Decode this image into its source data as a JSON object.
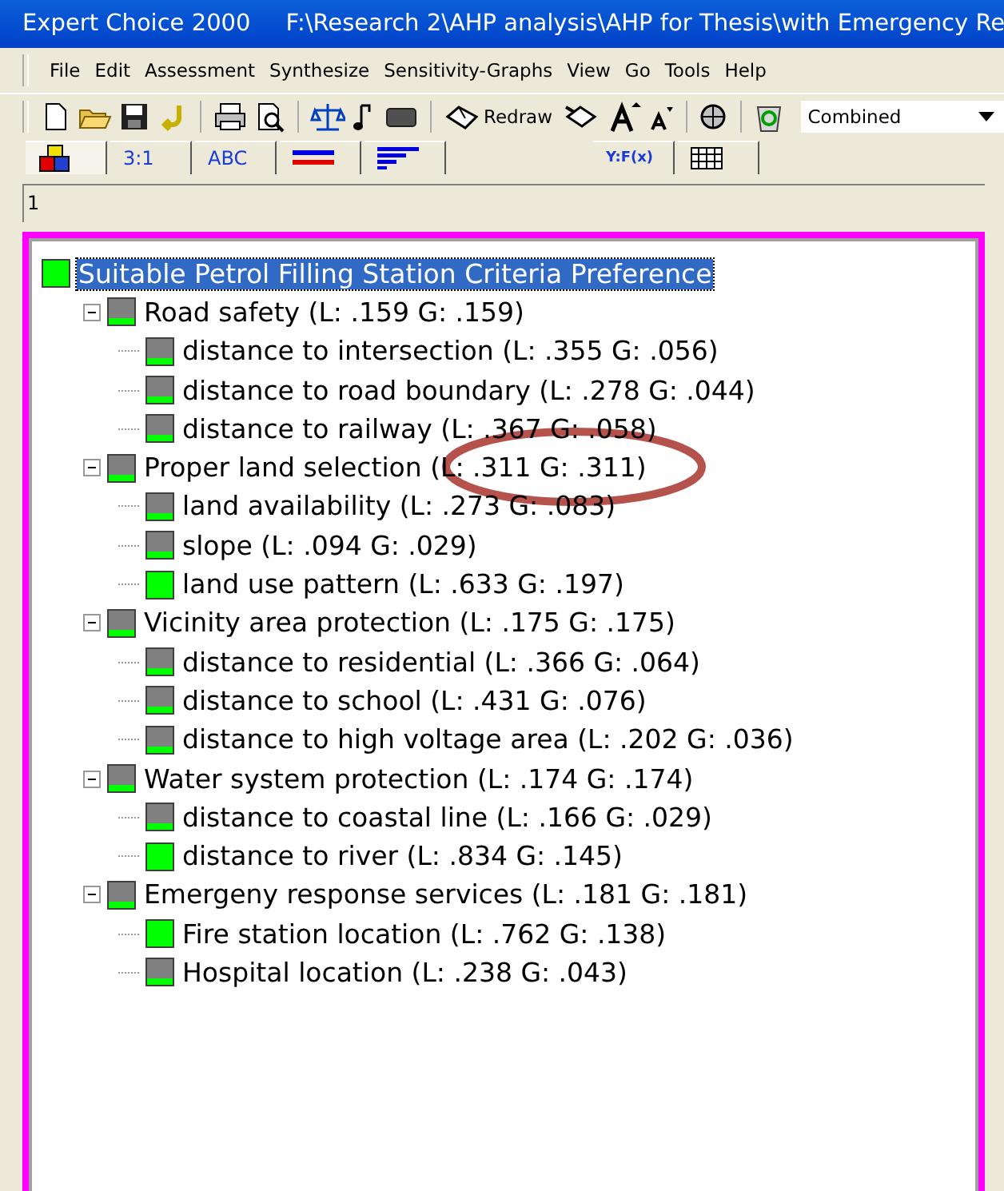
{
  "window": {
    "title_app": "Expert Choice 2000",
    "title_path": "F:\\Research 2\\AHP analysis\\AHP for Thesis\\with Emergency Re"
  },
  "menu": [
    "File",
    "Edit",
    "Assessment",
    "Synthesize",
    "Sensitivity-Graphs",
    "View",
    "Go",
    "Tools",
    "Help"
  ],
  "toolbar": {
    "redraw_label": "Redraw",
    "combo_value": "Combined"
  },
  "tabs": [
    {
      "selected": true
    },
    {
      "label": "3:1",
      "selected": false
    },
    {
      "label": "ABC",
      "selected": false
    },
    {
      "selected": false
    },
    {
      "selected": false
    },
    {
      "label": "Y:F(x)",
      "selected": false
    },
    {
      "selected": false
    }
  ],
  "path_field": {
    "value": "1"
  },
  "tree": {
    "label": "Suitable Petrol Filling Station Criteria Preference",
    "color": "#00ff00",
    "selected": true,
    "children": [
      {
        "label": "Road safety (L: .159  G: .159)",
        "color": "#808080",
        "selected": false,
        "expanded": true,
        "children": [
          {
            "label": "distance to intersection (L: .355  G: .056)",
            "color": "#808080",
            "selected": false
          },
          {
            "label": "distance to road boundary (L: .278  G: .044)",
            "color": "#808080",
            "selected": false
          },
          {
            "label": "distance to railway (L: .367  G: .058)",
            "color": "#808080",
            "selected": false
          }
        ]
      },
      {
        "label": "Proper land selection (L: .311  G: .311)",
        "color": "#808080",
        "selected": false,
        "expanded": true,
        "children": [
          {
            "label": "land availability (L: .273  G: .083)",
            "color": "#808080",
            "selected": false
          },
          {
            "label": "slope (L: .094  G: .029)",
            "color": "#808080",
            "selected": false
          },
          {
            "label": "land use pattern (L: .633  G: .197)",
            "color": "#00ff00",
            "selected": false
          }
        ]
      },
      {
        "label": "Vicinity area protection (L: .175  G: .175)",
        "color": "#808080",
        "selected": false,
        "expanded": true,
        "children": [
          {
            "label": "distance to residential (L: .366  G: .064)",
            "color": "#808080",
            "selected": false
          },
          {
            "label": "distance to school (L: .431  G: .076)",
            "color": "#808080",
            "selected": false
          },
          {
            "label": "distance to high voltage area (L: .202  G: .036)",
            "color": "#808080",
            "selected": false
          }
        ]
      },
      {
        "label": "Water system protection (L: .174  G: .174)",
        "color": "#808080",
        "selected": false,
        "expanded": true,
        "children": [
          {
            "label": "distance to coastal line (L: .166  G: .029)",
            "color": "#808080",
            "selected": false
          },
          {
            "label": "distance to river (L: .834  G: .145)",
            "color": "#00ff00",
            "selected": false
          }
        ]
      },
      {
        "label": "Emergeny response services (L: .181  G: .181)",
        "color": "#808080",
        "selected": false,
        "expanded": true,
        "children": [
          {
            "label": "Fire station location (L: .762  G: .138)",
            "color": "#00ff00",
            "selected": false
          },
          {
            "label": "Hospital location (L: .238  G: .043)",
            "color": "#808080",
            "selected": false
          }
        ]
      }
    ]
  }
}
